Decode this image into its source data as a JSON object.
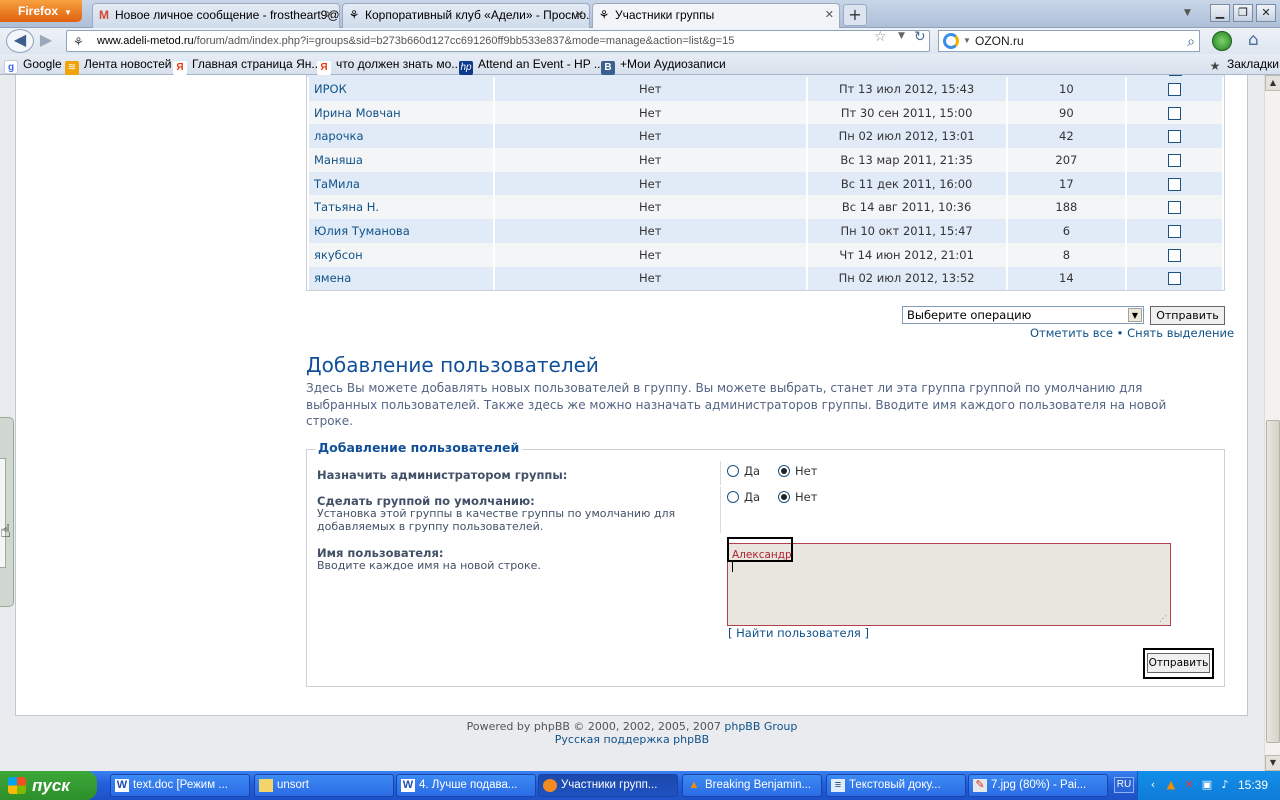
{
  "browser": {
    "app_button": "Firefox",
    "tabs": [
      {
        "title": "Новое личное сообщение - frostheart9@...",
        "icon": "gmail-icon"
      },
      {
        "title": "Корпоративный клуб «Адели» - Просмо...",
        "icon": "site-icon"
      },
      {
        "title": "Участники группы",
        "icon": "site-icon"
      }
    ],
    "new_tab": "+",
    "url_domain": "www.adeli-metod.ru",
    "url_path": "/forum/adm/index.php?i=groups&sid=b273b660d127cc691260ff9bb533e837&mode=manage&action=list&g=15",
    "search_value": "OZON.ru",
    "bookmarks": [
      {
        "label": "Google",
        "icon": "google-icon"
      },
      {
        "label": "Лента новостей",
        "icon": "rss-icon"
      },
      {
        "label": "Главная страница Ян...",
        "icon": "yandex-icon"
      },
      {
        "label": "что должен знать мо...",
        "icon": "yandex-icon"
      },
      {
        "label": "Attend an Event - HP ...",
        "icon": "hp-icon"
      },
      {
        "label": "+Мои Аудиозаписи",
        "icon": "vk-icon"
      }
    ],
    "bookmarks_menu": "Закладки"
  },
  "members": {
    "rows": [
      {
        "name": "ИРОК",
        "default": "Нет",
        "date": "Пт 13 июл 2012, 15:43",
        "posts": "10"
      },
      {
        "name": "Ирина Мовчан",
        "default": "Нет",
        "date": "Пт 30 сен 2011, 15:00",
        "posts": "90"
      },
      {
        "name": "ларочка",
        "default": "Нет",
        "date": "Пн 02 июл 2012, 13:01",
        "posts": "42"
      },
      {
        "name": "Маняша",
        "default": "Нет",
        "date": "Вс 13 мар 2011, 21:35",
        "posts": "207"
      },
      {
        "name": "ТаМила",
        "default": "Нет",
        "date": "Вс 11 дек 2011, 16:00",
        "posts": "17"
      },
      {
        "name": "Татьяна Н.",
        "default": "Нет",
        "date": "Вс 14 авг 2011, 10:36",
        "posts": "188"
      },
      {
        "name": "Юлия Туманова",
        "default": "Нет",
        "date": "Пн 10 окт 2011, 15:47",
        "posts": "6"
      },
      {
        "name": "якубсон",
        "default": "Нет",
        "date": "Чт 14 июн 2012, 21:01",
        "posts": "8"
      },
      {
        "name": "ямена",
        "default": "Нет",
        "date": "Пн 02 июл 2012, 13:52",
        "posts": "14"
      }
    ],
    "operation_placeholder": "Выберите операцию",
    "operation_submit": "Отправить",
    "mark_all": "Отметить все",
    "unmark_all": "Снять выделение",
    "bullet": "•"
  },
  "add_users": {
    "heading": "Добавление пользователей",
    "description": "Здесь Вы можете добавлять новых пользователей в группу. Вы можете выбрать, станет ли эта группа группой по умолчанию для выбранных пользователей. Также здесь же можно назначать администраторов группы. Вводите имя каждого пользователя на новой строке.",
    "legend": "Добавление пользователей",
    "leader_label": "Назначить администратором группы:",
    "default_label": "Сделать группой по умолчанию:",
    "default_hint": "Установка этой группы в качестве группы по умолчанию для добавляемых в группу пользователей.",
    "username_label": "Имя пользователя:",
    "username_hint": "Вводите каждое имя на новой строке.",
    "yes": "Да",
    "no": "Нет",
    "username_value": "Александр",
    "find_user": "[ Найти пользователя ]",
    "submit": "Отправить"
  },
  "footer": {
    "powered": "Powered by phpBB © 2000, 2002, 2005, 2007",
    "group": "phpBB Group",
    "support": "Русская поддержка phpBB"
  },
  "taskbar": {
    "start": "пуск",
    "tasks": [
      {
        "label": "text.doc [Режим ...",
        "icon": "word-icon"
      },
      {
        "label": "unsort",
        "icon": "folder-icon"
      },
      {
        "label": "4. Лучше подава...",
        "icon": "word-icon"
      },
      {
        "label": "Участники групп...",
        "icon": "firefox-icon"
      },
      {
        "label": "Breaking Benjamin...",
        "icon": "vlc-icon"
      },
      {
        "label": "Текстовый доку...",
        "icon": "notepad-icon"
      },
      {
        "label": "7.jpg (80%) - Pai...",
        "icon": "paint-icon"
      }
    ],
    "lang": "RU",
    "clock": "15:39"
  }
}
